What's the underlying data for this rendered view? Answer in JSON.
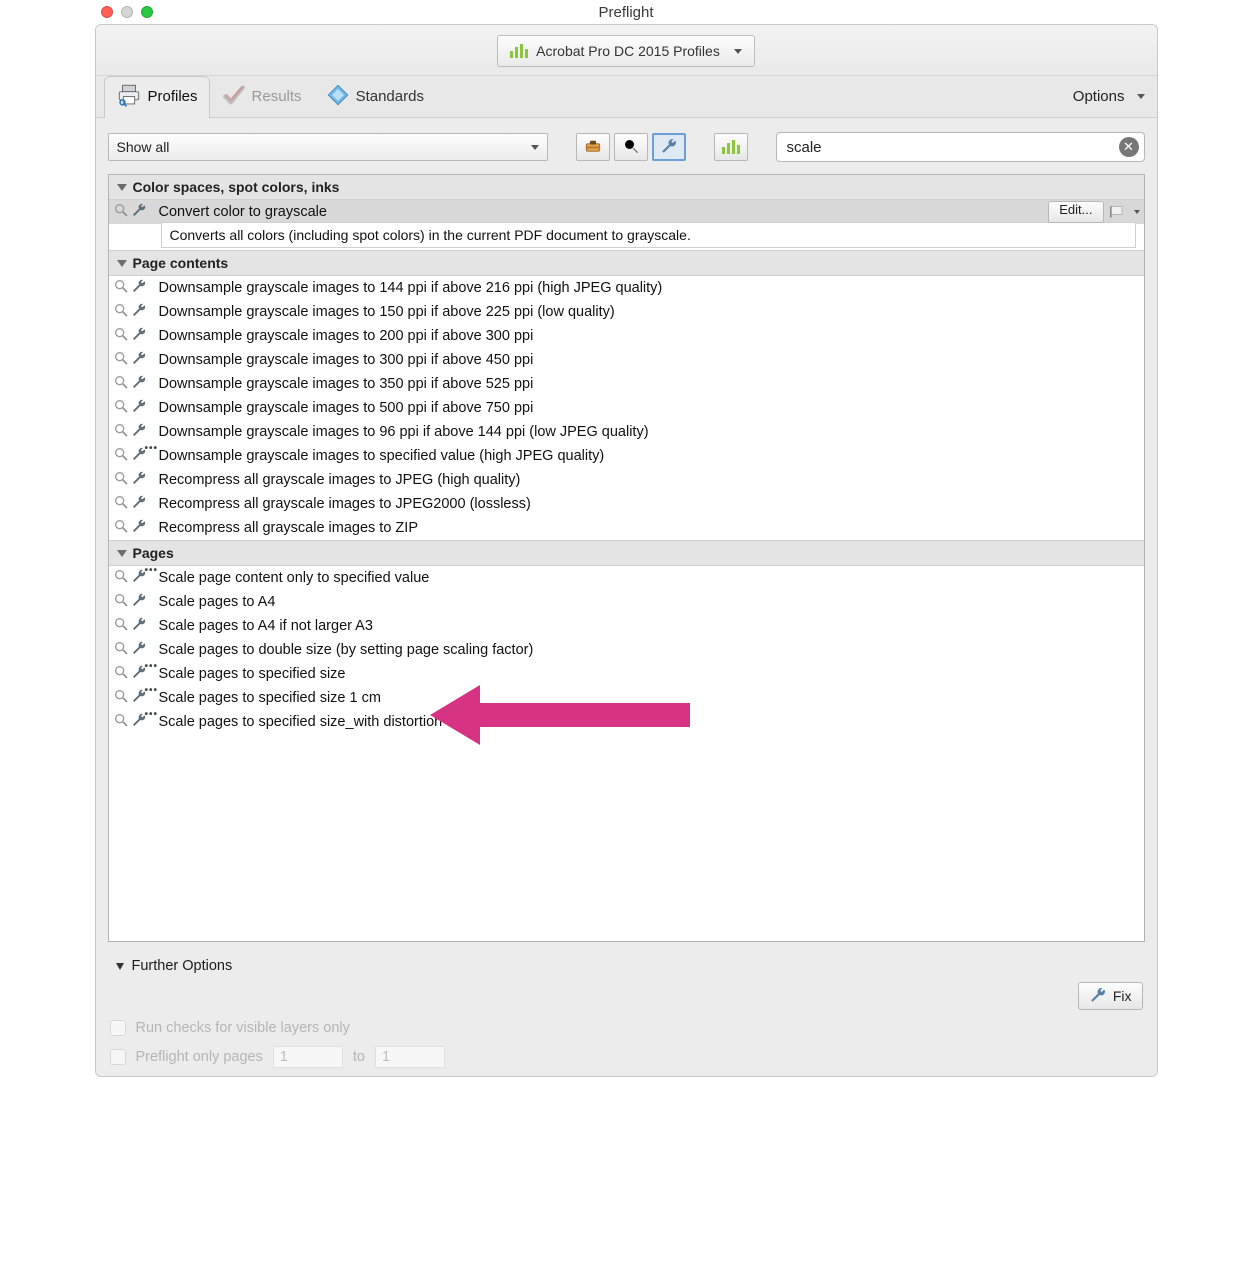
{
  "window_title": "Preflight",
  "profiles_dropdown": "Acrobat Pro DC 2015 Profiles",
  "tabs": {
    "profiles": "Profiles",
    "results": "Results",
    "standards": "Standards"
  },
  "options_label": "Options",
  "filter_select": "Show all",
  "search_value": "scale",
  "groups": [
    {
      "title": "Color spaces, spot colors, inks",
      "items": [
        {
          "label": "Convert color to grayscale",
          "selected": true,
          "edit_label": "Edit...",
          "description": "Converts all colors (including spot colors) in the current PDF document to grayscale."
        }
      ]
    },
    {
      "title": "Page contents",
      "items": [
        {
          "label": "Downsample grayscale images to 144 ppi if above 216 ppi (high JPEG quality)"
        },
        {
          "label": "Downsample grayscale images to 150 ppi if above 225 ppi (low quality)"
        },
        {
          "label": "Downsample grayscale images to 200 ppi if above 300 ppi"
        },
        {
          "label": "Downsample grayscale images to 300 ppi if above 450 ppi"
        },
        {
          "label": "Downsample grayscale images to 350 ppi if above 525 ppi"
        },
        {
          "label": "Downsample grayscale images to 500 ppi if above 750 ppi"
        },
        {
          "label": "Downsample grayscale images to 96 ppi if above 144 ppi (low JPEG quality)"
        },
        {
          "label": "Downsample grayscale images to specified value (high JPEG quality)",
          "dots": true
        },
        {
          "label": "Recompress all grayscale images to JPEG (high quality)"
        },
        {
          "label": "Recompress all grayscale images to JPEG2000 (lossless)"
        },
        {
          "label": "Recompress all grayscale images to ZIP"
        }
      ]
    },
    {
      "title": "Pages",
      "items": [
        {
          "label": "Scale page content only to specified value",
          "dots": true
        },
        {
          "label": "Scale pages to A4"
        },
        {
          "label": "Scale pages to A4 if not larger A3"
        },
        {
          "label": "Scale pages to double size (by setting page scaling factor)"
        },
        {
          "label": "Scale pages to specified size",
          "dots": true
        },
        {
          "label": "Scale pages to specified size 1 cm",
          "dots": true
        },
        {
          "label": "Scale pages to specified size_with distortion",
          "dots": true
        }
      ]
    }
  ],
  "further_options": "Further Options",
  "fix_label": "Fix",
  "footer": {
    "run_checks": "Run checks for visible layers only",
    "preflight_pages": "Preflight only pages",
    "to": "to",
    "page_from": "1",
    "page_to": "1"
  }
}
